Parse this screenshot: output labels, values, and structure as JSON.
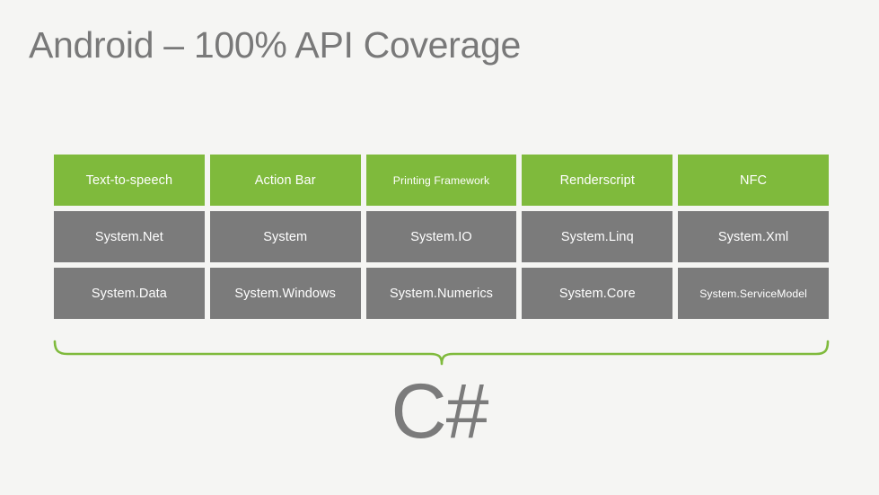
{
  "slide": {
    "title": "Android – 100% API Coverage",
    "background_color": "#f5f5f3",
    "title_color": "#797979",
    "green_color": "#7fba3c",
    "gray_color": "#7b7b7b",
    "brace_color": "#7fba3c",
    "footer_label": "C#"
  },
  "grid": {
    "rows": [
      {
        "style": "green",
        "cells": [
          {
            "label": "Text-to-speech"
          },
          {
            "label": "Action Bar"
          },
          {
            "label": "Printing Framework",
            "small": true
          },
          {
            "label": "Renderscript"
          },
          {
            "label": "NFC"
          }
        ]
      },
      {
        "style": "gray",
        "cells": [
          {
            "label": "System.Net"
          },
          {
            "label": "System"
          },
          {
            "label": "System.IO"
          },
          {
            "label": "System.Linq"
          },
          {
            "label": "System.Xml"
          }
        ]
      },
      {
        "style": "gray",
        "cells": [
          {
            "label": "System.Data"
          },
          {
            "label": "System.Windows"
          },
          {
            "label": "System.Numerics"
          },
          {
            "label": "System.Core"
          },
          {
            "label": "System.ServiceModel",
            "small": true
          }
        ]
      }
    ]
  }
}
